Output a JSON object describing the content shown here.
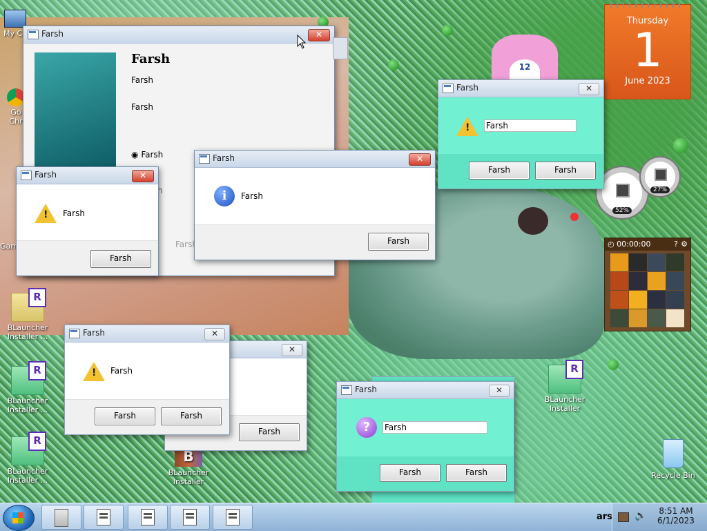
{
  "desktop": {
    "icons": [
      {
        "id": "my-computer",
        "label": "My Co"
      },
      {
        "id": "google-chrome",
        "label": "Go Chr"
      },
      {
        "id": "games",
        "label": "Gam"
      },
      {
        "id": "blauncher-1",
        "label": "BLauncher Installer ..."
      },
      {
        "id": "blauncher-2",
        "label": "BLauncher Installer ..."
      },
      {
        "id": "blauncher-3",
        "label": "BLauncher Installer ..."
      },
      {
        "id": "blauncher-4",
        "label": "BLauncher Installer"
      },
      {
        "id": "blauncher-5",
        "label": "BLauncher Installer"
      },
      {
        "id": "recycle-bin",
        "label": "Recycle Bin"
      }
    ]
  },
  "gadgets": {
    "calendar": {
      "weekday": "Thursday",
      "day": "1",
      "month_year": "June 2023"
    },
    "cpu_meter": {
      "cpu": "52%",
      "memory": "27%"
    },
    "puzzle": {
      "timer": "00:00:00"
    },
    "clock_gadget": {
      "number": "12"
    }
  },
  "windows": {
    "main_wizard": {
      "title": "Farsh",
      "heading": "Farsh",
      "line1": "Farsh",
      "line2": "Farsh",
      "radio_label": "Farsh",
      "partial_text": "h",
      "footer_button": "Farsh"
    },
    "warning_left": {
      "title": "Farsh",
      "message": "Farsh",
      "button": "Farsh"
    },
    "info_center": {
      "title": "Farsh",
      "message": "Farsh",
      "button": "Farsh"
    },
    "warning_input_topright": {
      "title": "Farsh",
      "input_value": "Farsh",
      "button1": "Farsh",
      "button2": "Farsh"
    },
    "warning_two_buttons": {
      "title": "Farsh",
      "message": "Farsh",
      "button1": "Farsh",
      "button2": "Farsh"
    },
    "behind_dialog": {
      "button": "Farsh"
    },
    "question_input": {
      "title": "Farsh",
      "input_value": "Farsh",
      "button1": "Farsh",
      "button2": "Farsh"
    }
  },
  "taskbar": {
    "tray_text": "ars",
    "time": "8:51 AM",
    "date": "6/1/2023"
  },
  "colors": {
    "mint_dialog": "#72f0d2",
    "calendar_orange": "#e8641f",
    "taskbar": "#a9c8e6"
  }
}
